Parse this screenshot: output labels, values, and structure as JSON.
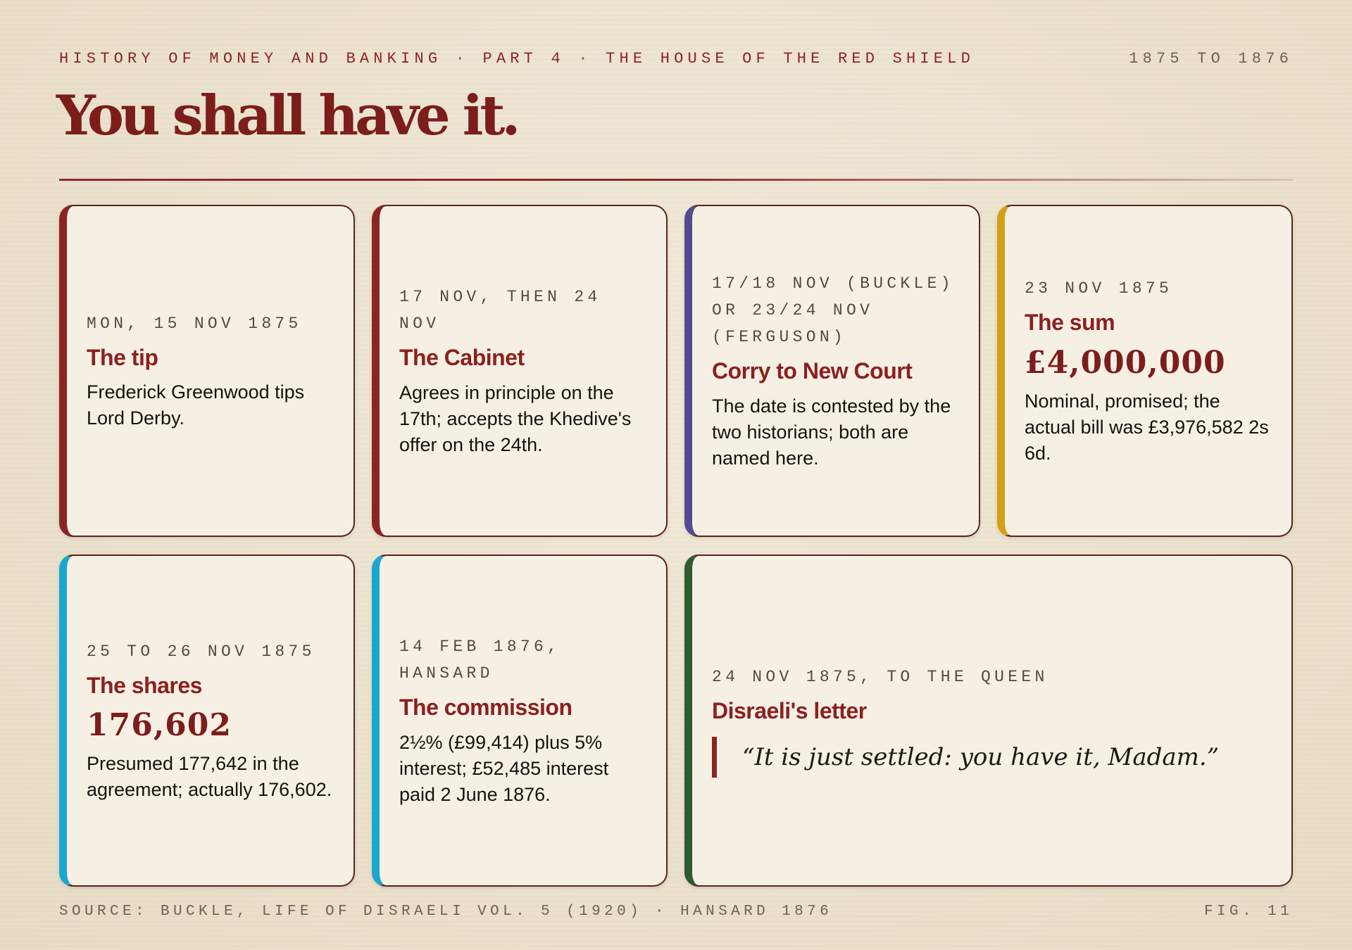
{
  "header": {
    "series": "History of Money and Banking",
    "part": "Part 4",
    "chapter": "The House of the Red Shield",
    "separator": "·",
    "date_range": "1875 to 1876"
  },
  "title": "You shall have it.",
  "colors": {
    "accent_red": "#8b2424",
    "accent_purple": "#56498f",
    "accent_gold": "#d4a017",
    "accent_cyan": "#1aa7cf",
    "accent_green": "#2e5a31",
    "paper": "#f6f0e4"
  },
  "cards": [
    {
      "date": "Mon, 15 Nov 1875",
      "heading": "The tip",
      "text": "Frederick Greenwood tips Lord Derby."
    },
    {
      "date": "17 Nov, then 24 Nov",
      "heading": "The Cabinet",
      "text": "Agrees in principle on the 17th; accepts the Khedive's offer on the 24th."
    },
    {
      "date": "17/18 Nov (Buckle) or 23/24 Nov (Ferguson)",
      "heading": "Corry to New Court",
      "text": "The date is contested by the two historians; both are named here."
    },
    {
      "date": "23 Nov 1875",
      "heading": "The sum",
      "figure": "£4,000,000",
      "text": "Nominal, promised; the actual bill was £3,976,582 2s 6d."
    },
    {
      "date": "25 to 26 Nov 1875",
      "heading": "The shares",
      "figure": "176,602",
      "text": "Presumed 177,642 in the agreement; actually 176,602."
    },
    {
      "date": "14 Feb 1876, Hansard",
      "heading": "The commission",
      "text": "2½% (£99,414) plus 5% interest; £52,485 interest paid 2 June 1876."
    },
    {
      "date": "24 Nov 1875, to the Queen",
      "heading": "Disraeli's letter",
      "quote": "“It is just settled: you have it, Madam.”"
    }
  ],
  "footer": {
    "source": "Source: Buckle, Life of Disraeli Vol. 5 (1920)",
    "separator": "·",
    "source_2": "Hansard 1876",
    "figure_label": "Fig. 11"
  }
}
